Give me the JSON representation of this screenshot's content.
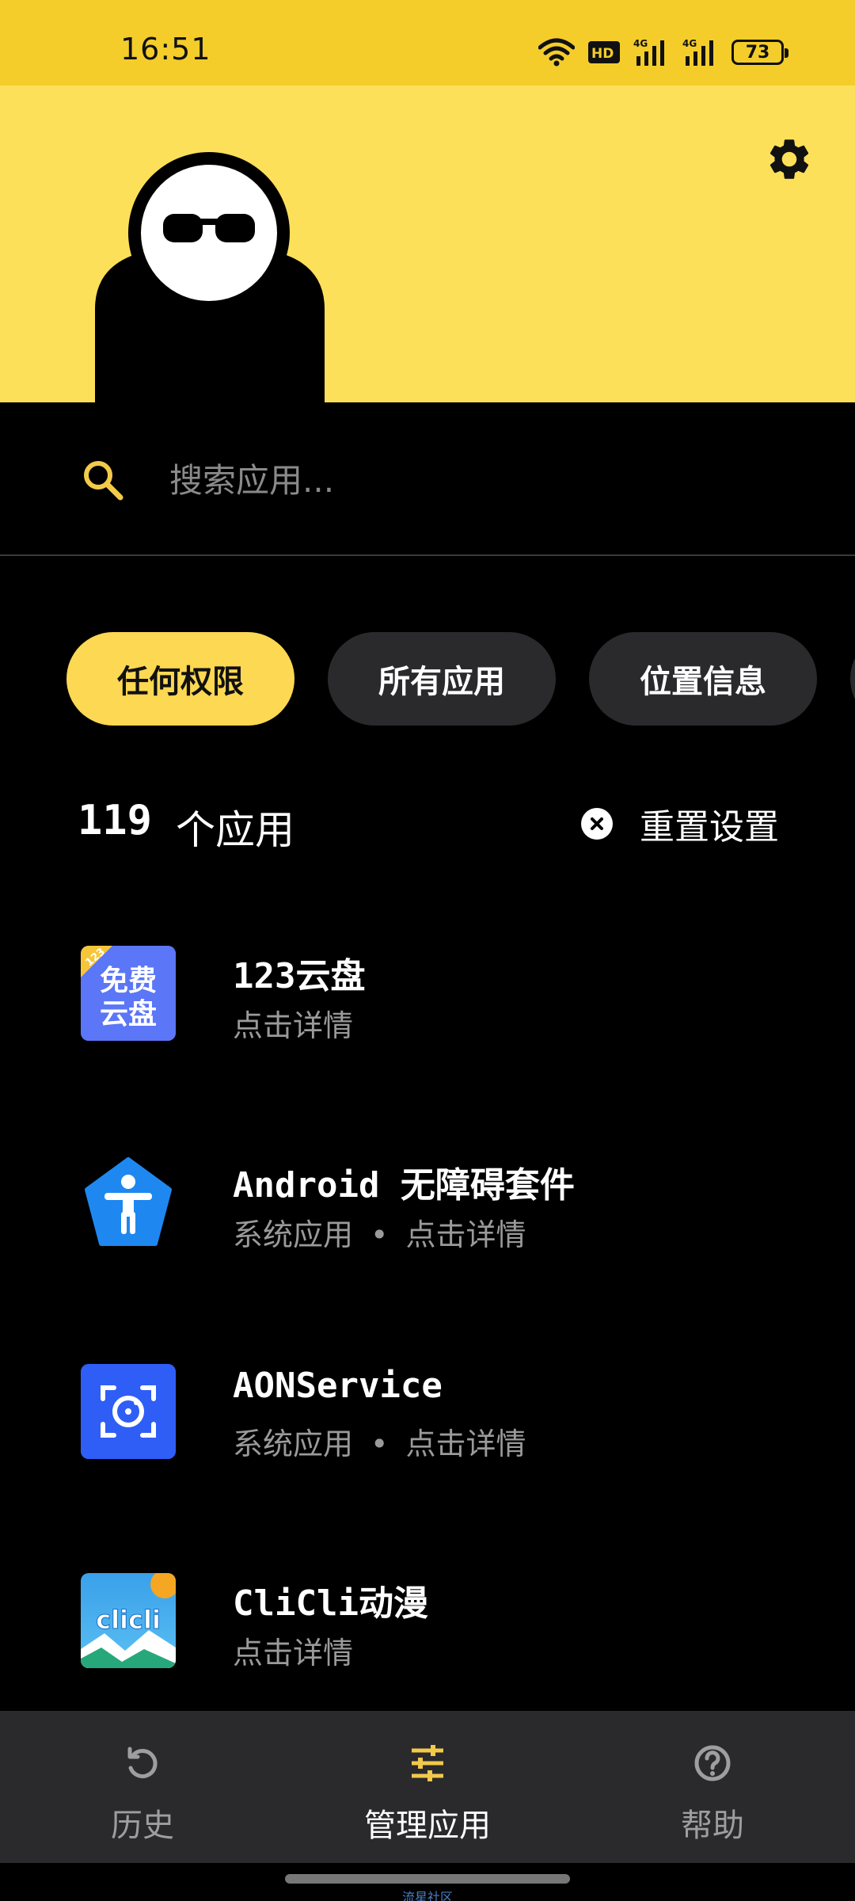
{
  "status_bar": {
    "time": "16:51",
    "battery": "73",
    "network_labels": [
      "HD",
      "4G",
      "4G"
    ]
  },
  "header": {
    "settings_icon": "gear-icon",
    "mascot": "sunglasses-avatar"
  },
  "search": {
    "placeholder": "搜索应用...",
    "icon": "search-icon"
  },
  "filters": {
    "chips": [
      {
        "label": "任何权限",
        "active": true
      },
      {
        "label": "所有应用",
        "active": false
      },
      {
        "label": "位置信息",
        "active": false
      }
    ]
  },
  "summary": {
    "count": "119",
    "count_label": "个应用",
    "reset_label": "重置设置"
  },
  "apps": [
    {
      "name": "123云盘",
      "tag": "",
      "detail": "点击详情",
      "icon_text": "免费\n云盘"
    },
    {
      "name": "Android 无障碍套件",
      "tag": "系统应用",
      "detail": "点击详情"
    },
    {
      "name": "AONService",
      "tag": "系统应用",
      "detail": "点击详情"
    },
    {
      "name": "CliCli动漫",
      "tag": "",
      "detail": "点击详情",
      "icon_text": "clicli"
    }
  ],
  "bottom_nav": {
    "items": [
      {
        "label": "历史",
        "icon": "history-icon",
        "active": false
      },
      {
        "label": "管理应用",
        "icon": "tune-icon",
        "active": true
      },
      {
        "label": "帮助",
        "icon": "help-icon",
        "active": false
      }
    ]
  },
  "watermark": "流星社区",
  "colors": {
    "accent": "#fcd853",
    "status_bar": "#f4cd2a",
    "header_bg": "#fde05a",
    "background": "#000000",
    "nav_bg": "#2a2a2c"
  }
}
